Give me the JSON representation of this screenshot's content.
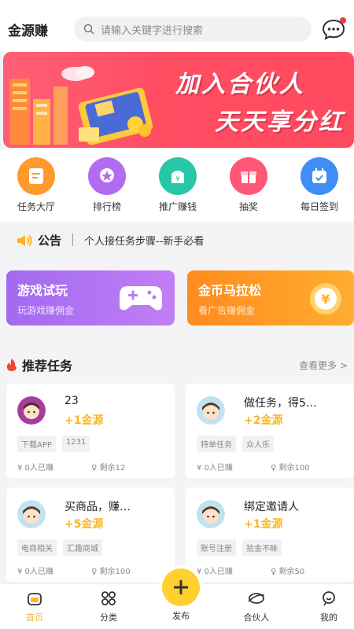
{
  "header": {
    "app_title": "金源赚",
    "search_placeholder": "请输入关键字进行搜索"
  },
  "banner": {
    "line1": "加入合伙人",
    "line2": "天天享分红"
  },
  "quick_menu": [
    {
      "label": "任务大厅",
      "icon": "task-hall-icon",
      "color": "#ff9a2e"
    },
    {
      "label": "排行榜",
      "icon": "ranking-icon",
      "color": "#b26cf2"
    },
    {
      "label": "推广赚钱",
      "icon": "promote-money-icon",
      "color": "#27c7a8"
    },
    {
      "label": "抽奖",
      "icon": "lottery-icon",
      "color": "#ff5777"
    },
    {
      "label": "每日签到",
      "icon": "daily-checkin-icon",
      "color": "#3d8ff5"
    }
  ],
  "notice": {
    "title": "公告",
    "text": "个人接任务步骤--新手必看"
  },
  "promos": [
    {
      "title": "游戏试玩",
      "subtitle": "玩游戏赚佣金",
      "icon": "gamepad-icon"
    },
    {
      "title": "金币马拉松",
      "subtitle": "看广告赚佣金",
      "icon": "yen-coin-icon"
    }
  ],
  "recommend": {
    "title": "推荐任务",
    "more": "查看更多 >"
  },
  "tasks": [
    {
      "title": "23",
      "reward": "+1金源",
      "tags": [
        "下载APP",
        "1231"
      ],
      "earned": "¥ 0人已赚",
      "remaining": "剩余12"
    },
    {
      "title": "做任务，得5…",
      "reward": "+2金源",
      "tags": [
        "特单任务",
        "众人乐"
      ],
      "earned": "¥ 0人已赚",
      "remaining": "剩余100"
    },
    {
      "title": "买商品，赚…",
      "reward": "+5金源",
      "tags": [
        "电商相关",
        "汇趣商城"
      ],
      "earned": "¥ 0人已赚",
      "remaining": "剩余100"
    },
    {
      "title": "绑定邀请人",
      "reward": "+1金源",
      "tags": [
        "账号注册",
        "拾金不昧"
      ],
      "earned": "¥ 0人已赚",
      "remaining": "剩余50"
    }
  ],
  "tabbar": {
    "home": "首页",
    "category": "分类",
    "publish": "发布",
    "partner": "合伙人",
    "mine": "我的"
  },
  "colors": {
    "accent": "#f5b82e",
    "banner": "#ff4d62",
    "promo_purple": "#a16af0",
    "promo_orange": "#ff8b1e"
  }
}
